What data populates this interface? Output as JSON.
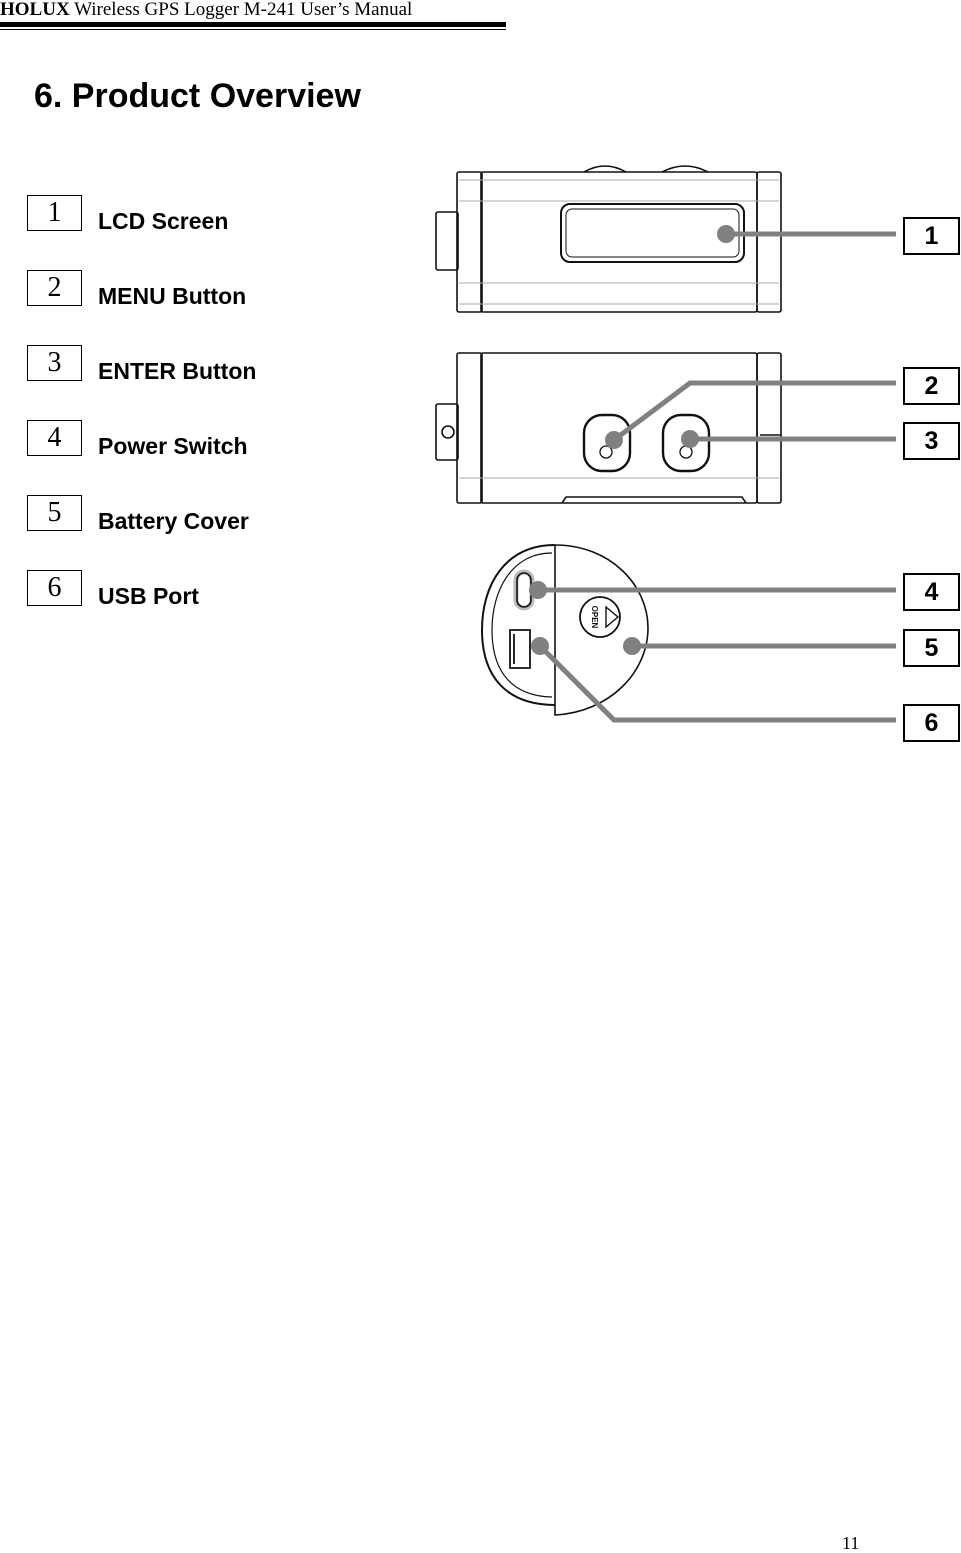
{
  "header": {
    "brand": "HOLUX",
    "title_rest": " Wireless GPS Logger M-241 User’s Manual"
  },
  "section": {
    "title": "6.  Product Overview"
  },
  "legend": [
    {
      "number": "1",
      "label": "LCD Screen"
    },
    {
      "number": "2",
      "label": "MENU Button"
    },
    {
      "number": "3",
      "label": "ENTER Button"
    },
    {
      "number": "4",
      "label": "Power Switch"
    },
    {
      "number": "5",
      "label": "Battery Cover"
    },
    {
      "number": "6",
      "label": "USB Port"
    }
  ],
  "callouts": [
    "1",
    "2",
    "3",
    "4",
    "5",
    "6"
  ],
  "diagram": {
    "views": [
      "front-view",
      "top-view",
      "end-view"
    ],
    "end_cap_text": "OPEN",
    "leader_color": "#808080"
  },
  "footer": {
    "page_number": "11"
  }
}
